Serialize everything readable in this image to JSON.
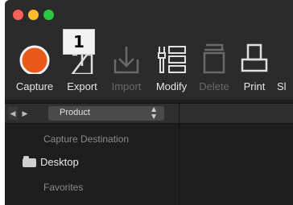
{
  "toolbar": {
    "items": [
      {
        "label": "Capture",
        "icon": "capture-icon",
        "enabled": true
      },
      {
        "label": "Export",
        "icon": "export-icon",
        "enabled": true
      },
      {
        "label": "Import",
        "icon": "import-icon",
        "enabled": false
      },
      {
        "label": "Modify",
        "icon": "modify-icon",
        "enabled": true
      },
      {
        "label": "Delete",
        "icon": "delete-icon",
        "enabled": false
      },
      {
        "label": "Print",
        "icon": "print-icon",
        "enabled": true
      },
      {
        "label": "Sl",
        "icon": "slideshow-icon",
        "enabled": true
      }
    ],
    "capture_color": "#e8591a"
  },
  "annotation": {
    "badge_text": "1"
  },
  "pathbar": {
    "selected_source": "Product"
  },
  "sidebar": {
    "capture_destination_title": "Capture Destination",
    "destination": "Desktop",
    "favorites_title": "Favorites"
  }
}
